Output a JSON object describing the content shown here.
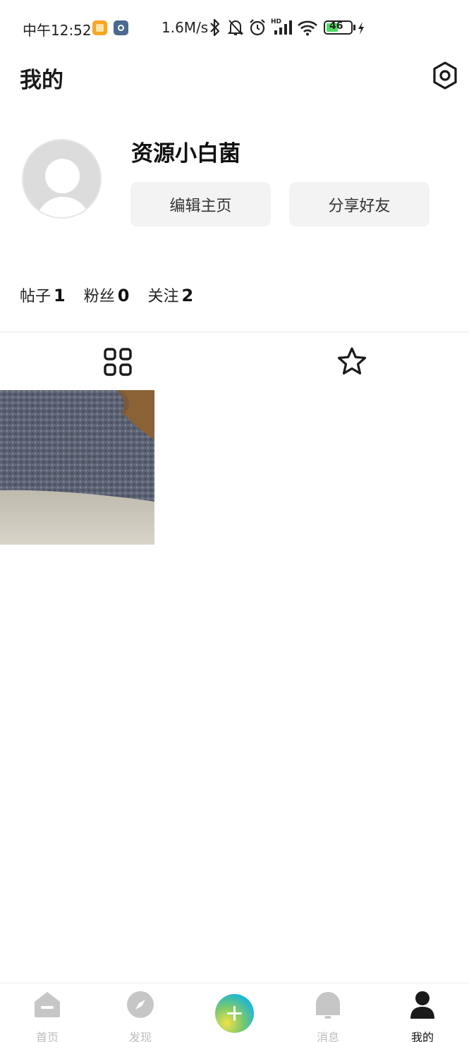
{
  "status_bar": {
    "time": "中午12:52",
    "net_speed": "1.6M/s",
    "battery_level": "46",
    "signal_label": "HD"
  },
  "header": {
    "title": "我的"
  },
  "profile": {
    "username": "资源小白菌",
    "edit_button": "编辑主页",
    "share_button": "分享好友"
  },
  "stats": [
    {
      "label": "帖子",
      "value": "1"
    },
    {
      "label": "粉丝",
      "value": "0"
    },
    {
      "label": "关注",
      "value": "2"
    }
  ],
  "tabs": [
    {
      "icon": "grid-icon",
      "active": true
    },
    {
      "icon": "star-icon",
      "active": false
    }
  ],
  "bottom_nav": {
    "home": "首页",
    "discover": "发现",
    "add": "add-icon",
    "messages": "消息",
    "me": "我的"
  },
  "colors": {
    "active_nav": "#111111",
    "inactive_nav": "#bdbdbd",
    "button_bg": "#f3f3f3"
  }
}
